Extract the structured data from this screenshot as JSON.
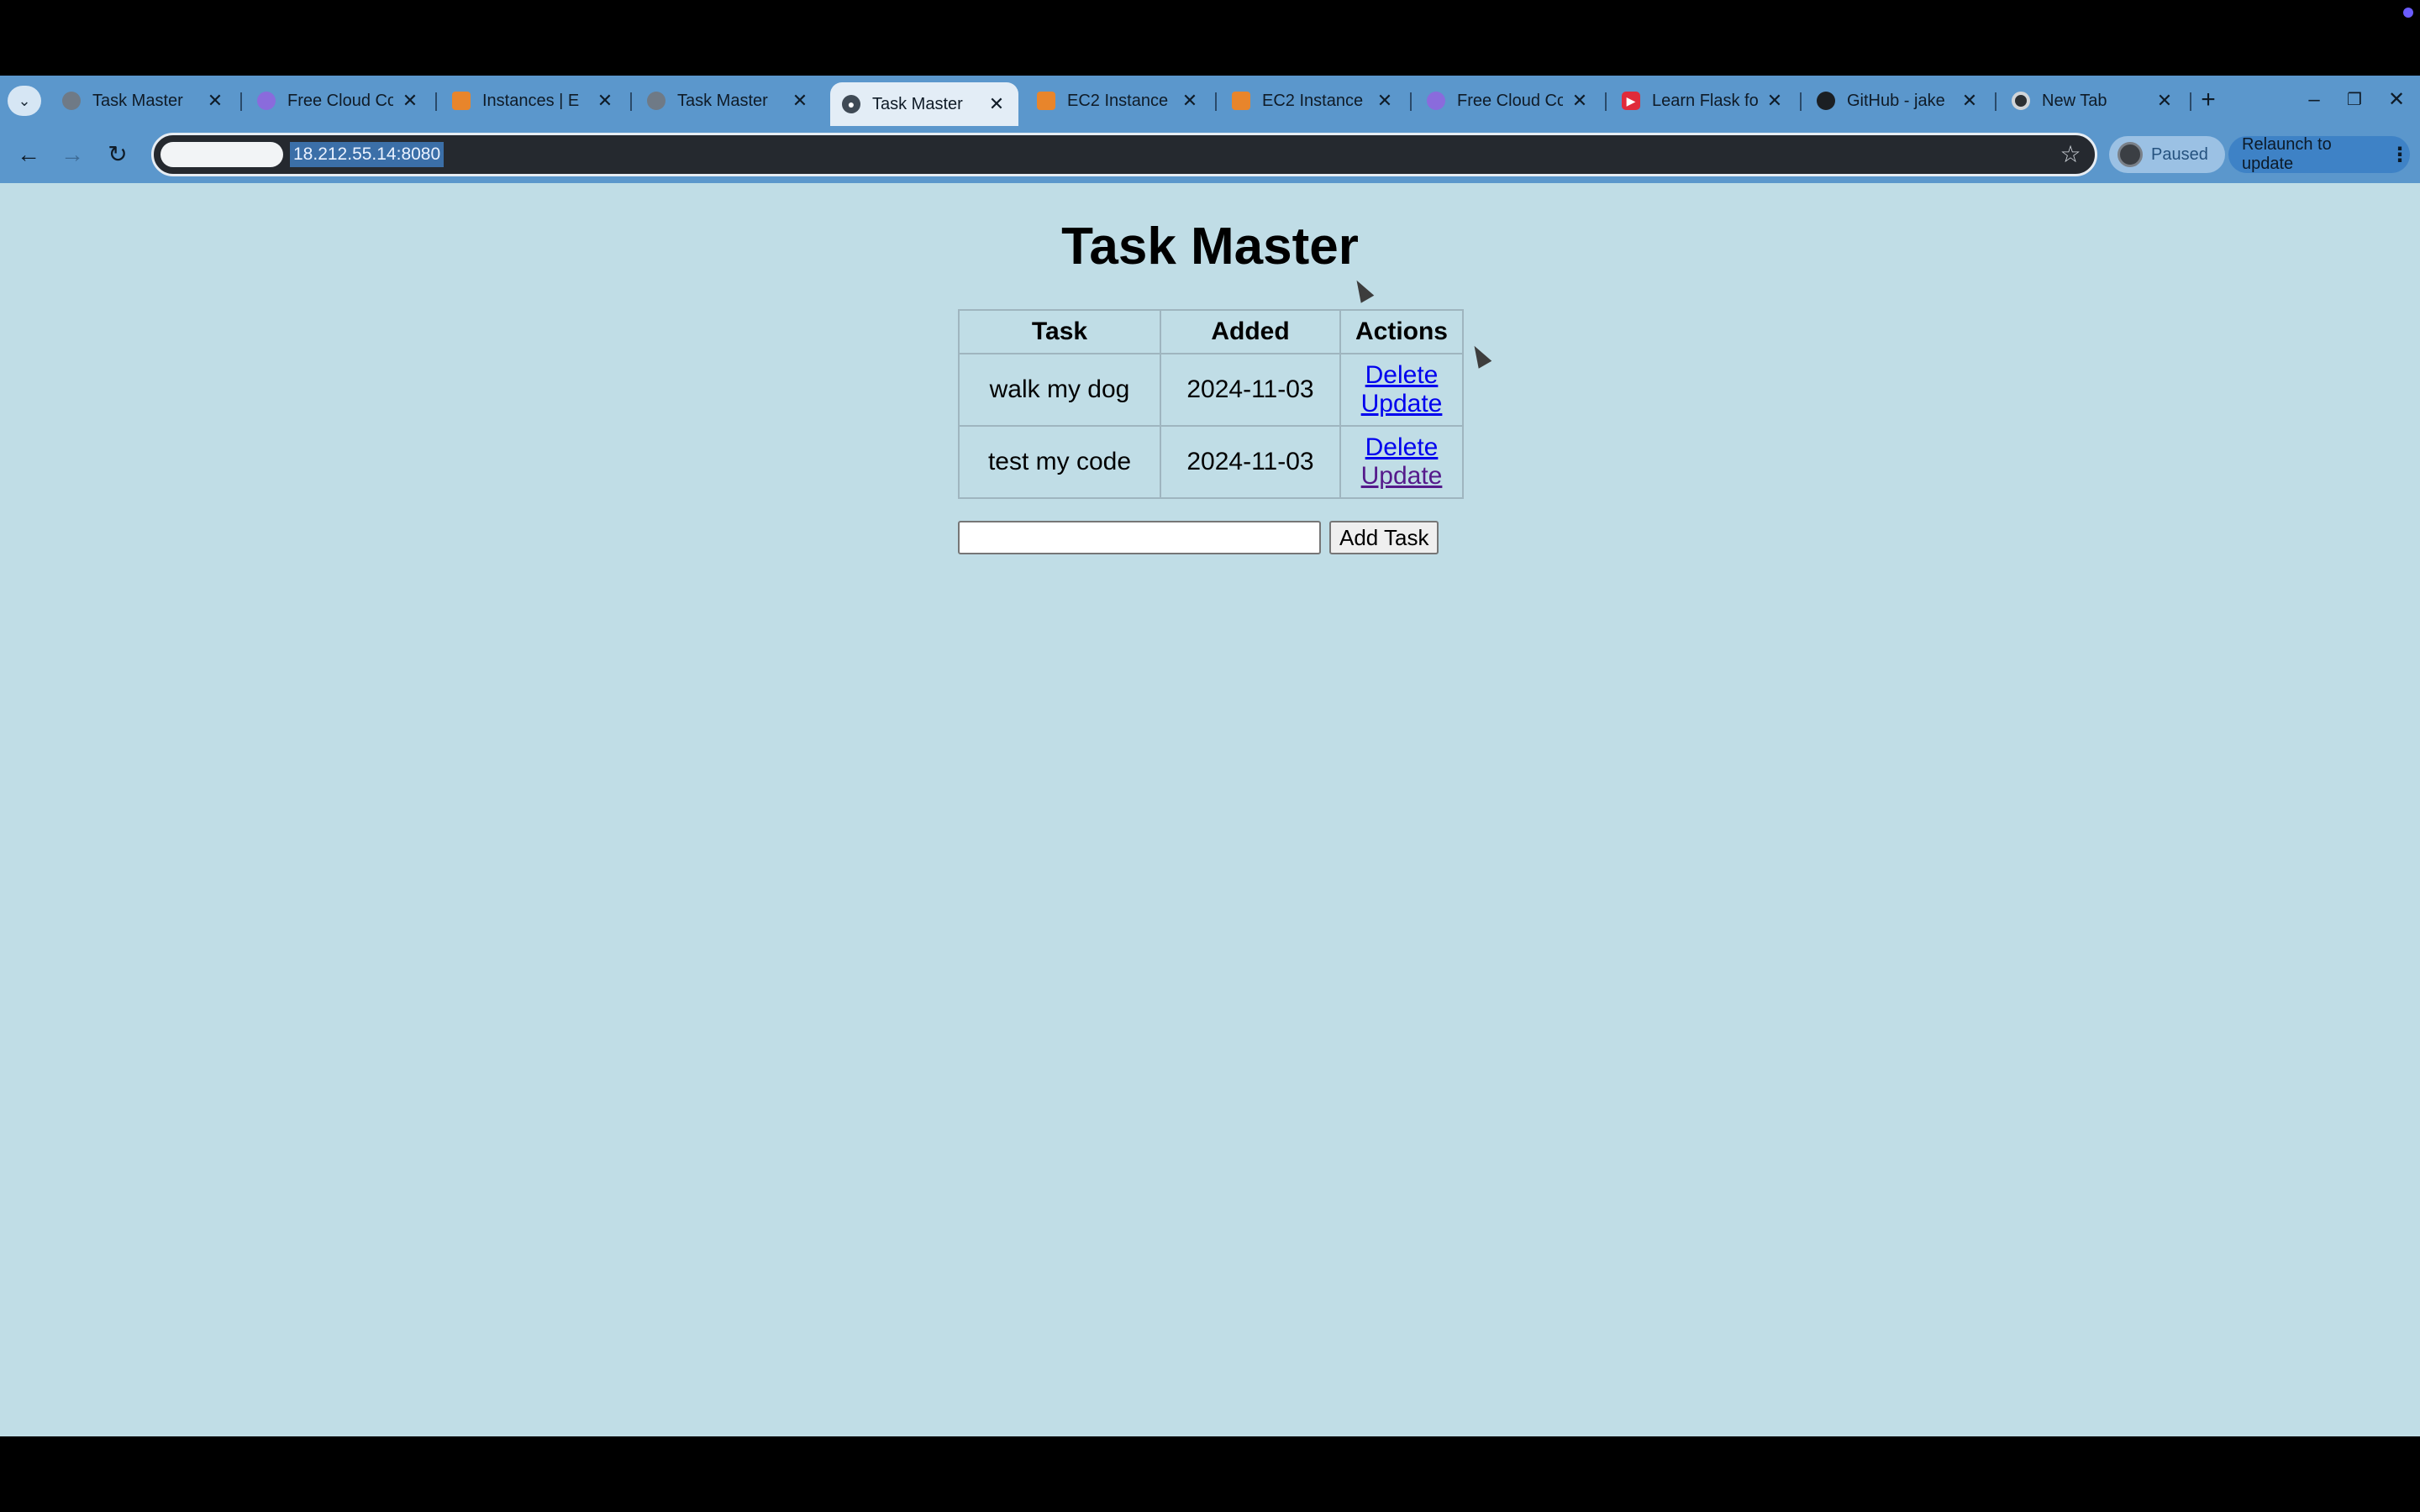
{
  "browser": {
    "tabs": [
      {
        "title": "Task Master",
        "favicon": "globe-grey-icon",
        "active": false
      },
      {
        "title": "Free Cloud Co",
        "favicon": "cloud-purple-icon",
        "active": false
      },
      {
        "title": "Instances | E",
        "favicon": "aws-orange-icon",
        "active": false
      },
      {
        "title": "Task Master",
        "favicon": "globe-grey-icon",
        "active": false
      },
      {
        "title": "Task Master",
        "favicon": "globe-icon",
        "active": true
      },
      {
        "title": "EC2 Instance",
        "favicon": "ec2-orange-icon",
        "active": false
      },
      {
        "title": "EC2 Instance",
        "favicon": "ec2-orange-icon",
        "active": false
      },
      {
        "title": "Free Cloud Co",
        "favicon": "cloud-purple-icon",
        "active": false
      },
      {
        "title": "Learn Flask fo",
        "favicon": "youtube-icon",
        "active": false
      },
      {
        "title": "GitHub - jake",
        "favicon": "github-icon",
        "active": false
      },
      {
        "title": "New Tab",
        "favicon": "chrome-icon",
        "active": false
      }
    ],
    "url": "18.212.55.14:8080",
    "profile_status": "Paused",
    "relaunch_label": "Relaunch to update",
    "colors": {
      "tabstrip": "#5b97cc",
      "active_tab": "#e3edf6",
      "omnibox": "#25292f",
      "relaunch": "#3e82c6"
    }
  },
  "page": {
    "title": "Task Master",
    "background": "#c0dde6",
    "table": {
      "headers": [
        "Task",
        "Added",
        "Actions"
      ],
      "rows": [
        {
          "task": "walk my dog",
          "added": "2024-11-03",
          "delete_label": "Delete",
          "update_label": "Update"
        },
        {
          "task": "test my code",
          "added": "2024-11-03",
          "delete_label": "Delete",
          "update_label": "Update"
        }
      ]
    },
    "form": {
      "input_value": "",
      "button_label": "Add Task"
    }
  }
}
